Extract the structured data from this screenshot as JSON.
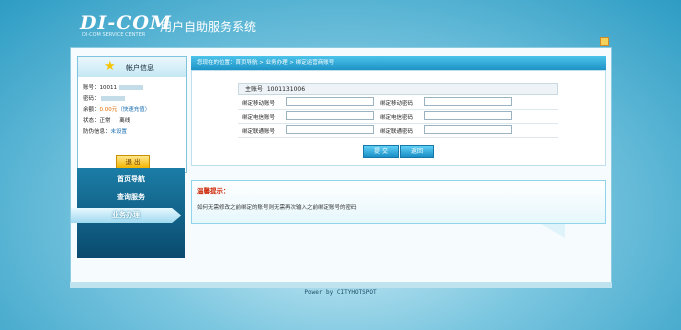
{
  "header": {
    "logo": "DI-COM",
    "logo_sub": "DI-COM SERVICE CENTER",
    "system_title": "用户自助服务系统"
  },
  "account": {
    "title": "帐户信息",
    "account_label": "账号：",
    "account_value": "10011",
    "password_label": "密码：",
    "balance_label": "余额：",
    "balance_value": "0.00元",
    "recharge_link": "（快速充值）",
    "status_label": "状态：",
    "status_value": "正常",
    "status_extra": "离线",
    "security_label": "防伪信息：",
    "security_value": "未设置",
    "exit_label": "退 出"
  },
  "nav": {
    "items": [
      "首页导航",
      "查询服务",
      "业务办理"
    ],
    "active_index": 2
  },
  "breadcrumb": "您现在的位置：首页导航 > 业务办理 > 绑定运营商账号",
  "form": {
    "main_account_label": "主账号",
    "main_account_value": "1001131006",
    "rows": [
      {
        "account_label": "绑定移动账号",
        "password_label": "绑定移动密码"
      },
      {
        "account_label": "绑定电信账号",
        "password_label": "绑定电信密码"
      },
      {
        "account_label": "绑定联通账号",
        "password_label": "绑定联通密码"
      }
    ],
    "submit_label": "提 交",
    "back_label": "返回"
  },
  "tips": {
    "title": "温馨提示：",
    "body": "如何无需修改之前绑定的账号则无需再次输入之前绑定账号的密码"
  },
  "footer": "Power by CITYHOTSPOT"
}
